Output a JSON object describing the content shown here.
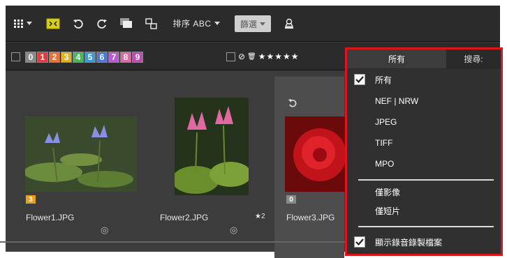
{
  "toolbar": {
    "sort_label": "排序 ABC",
    "filter_label": "篩選"
  },
  "labels": {
    "items": [
      "0",
      "1",
      "2",
      "3",
      "4",
      "5",
      "6",
      "7",
      "8",
      "9"
    ],
    "colors": [
      "#8a8a8a",
      "#e23b3b",
      "#f07030",
      "#e2b21f",
      "#4ab85a",
      "#3a9ad8",
      "#4a78d8",
      "#b75ad8",
      "#e06aa0",
      "#c04ab8"
    ]
  },
  "rating": {
    "reject_glyph": "⊘",
    "trash_glyph": "🗑",
    "stars": "★★★★★"
  },
  "thumbnails": [
    {
      "file_name": "Flower1.JPG",
      "badge": "3",
      "badge_color": "#e8a020",
      "rating_text": ""
    },
    {
      "file_name": "Flower2.JPG",
      "badge": "",
      "badge_color": "",
      "rating_text": "★2"
    },
    {
      "file_name": "Flower3.JPG",
      "badge": "0",
      "badge_color": "#8a8a8a",
      "rating_text": ""
    }
  ],
  "filter_panel": {
    "tab_all": "所有",
    "tab_search": "搜尋:",
    "menu": [
      {
        "label": "所有",
        "checked": true
      },
      {
        "label": "NEF | NRW",
        "checked": false
      },
      {
        "label": "JPEG",
        "checked": false
      },
      {
        "label": "TIFF",
        "checked": false
      },
      {
        "label": "MPO",
        "checked": false
      },
      {
        "label": "僅影像",
        "checked": false
      },
      {
        "label": "僅短片",
        "checked": false
      },
      {
        "label": "顯示錄音錄製檔案",
        "checked": true
      }
    ]
  },
  "colors": {
    "highlight_border": "#e0131b",
    "toolbar_bg": "#2b2b2b",
    "content_bg": "#3c3c3c"
  }
}
